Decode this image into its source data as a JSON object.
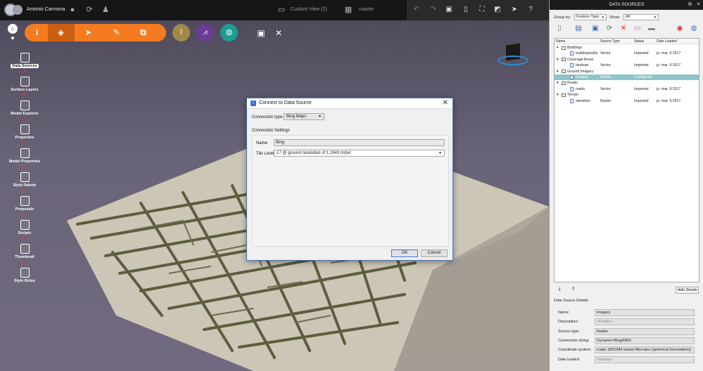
{
  "topbar": {
    "user_name": "Antonio Carmona",
    "view_name": "Custom View (2)",
    "branch": "master"
  },
  "left_panel": [
    {
      "label": "Data Sources",
      "icon": "database-icon",
      "active": true
    },
    {
      "label": "Surface Layers",
      "icon": "layers-icon",
      "active": false
    },
    {
      "label": "Model Explorer",
      "icon": "model-explorer-icon",
      "active": false
    },
    {
      "label": "Properties",
      "icon": "properties-icon",
      "active": false
    },
    {
      "label": "Model Properties",
      "icon": "model-properties-icon",
      "active": false
    },
    {
      "label": "Style Palette",
      "icon": "style-palette-icon",
      "active": false
    },
    {
      "label": "Proposals",
      "icon": "proposals-icon",
      "active": false
    },
    {
      "label": "Scripts",
      "icon": "scripts-icon",
      "active": false
    },
    {
      "label": "Thumbnail",
      "icon": "thumbnail-icon",
      "active": false
    },
    {
      "label": "Style Rules",
      "icon": "style-rules-icon",
      "active": false
    }
  ],
  "dialog": {
    "title": "Connect to Data Source",
    "connection_type_label": "Connection type:",
    "connection_type_value": "Bing Maps",
    "settings_label": "Connection Settings",
    "name_label": "Name",
    "name_value": "Bing",
    "tile_level_label": "Tile Level",
    "tile_level_value": "17 @ ground resolution of 1.1943 m/pxl",
    "ok_label": "OK",
    "cancel_label": "Cancel"
  },
  "data_sources_panel": {
    "title": "DATA SOURCES",
    "group_by_label": "Group by:",
    "group_by_value": "Feature Type",
    "show_label": "Show:",
    "show_value": "All",
    "columns": [
      "Name",
      "Source Type",
      "Status",
      "Date Loaded"
    ],
    "rows": [
      {
        "kind": "group",
        "name": "Buildings",
        "type": "",
        "status": "",
        "date": "",
        "selected": false
      },
      {
        "kind": "item",
        "name": "buildingmultis",
        "type": "Vector",
        "status": "Imported",
        "date": "ju. mar. 9 2017",
        "selected": false
      },
      {
        "kind": "group",
        "name": "Coverage Areas",
        "type": "",
        "status": "",
        "date": "",
        "selected": false
      },
      {
        "kind": "item",
        "name": "landuse",
        "type": "Vector",
        "status": "Imported",
        "date": "ju. mar. 9 2017",
        "selected": false
      },
      {
        "kind": "group",
        "name": "Ground Imagery",
        "type": "",
        "status": "",
        "date": "",
        "selected": false
      },
      {
        "kind": "item",
        "name": "imagery",
        "type": "Raster",
        "status": "Configured",
        "date": "",
        "selected": true
      },
      {
        "kind": "group",
        "name": "Roads",
        "type": "",
        "status": "",
        "date": "",
        "selected": false
      },
      {
        "kind": "item",
        "name": "roads",
        "type": "Vector",
        "status": "Imported",
        "date": "ju. mar. 9 2017",
        "selected": false
      },
      {
        "kind": "group",
        "name": "Terrain",
        "type": "",
        "status": "",
        "date": "",
        "selected": false
      },
      {
        "kind": "item",
        "name": "elevation",
        "type": "Raster",
        "status": "Imported",
        "date": "ju. mar. 9 2017",
        "selected": false
      }
    ],
    "hide_details_label": "Hide Details",
    "details_title": "Data Source Details",
    "details": [
      {
        "label": "Name:",
        "value": "imagery",
        "empty": false
      },
      {
        "label": "Description:",
        "value": "<Empty>",
        "empty": true
      },
      {
        "label": "Source type:",
        "value": "Raster",
        "empty": false
      },
      {
        "label": "Connection string:",
        "value": "Dynamic=BingWMS",
        "empty": false
      },
      {
        "label": "Coordinate system:",
        "value": "rcator (WGS84 based Mercator (spherical formulation))",
        "empty": false
      },
      {
        "label": "Date loaded:",
        "value": "<Empty>",
        "empty": true
      }
    ]
  }
}
